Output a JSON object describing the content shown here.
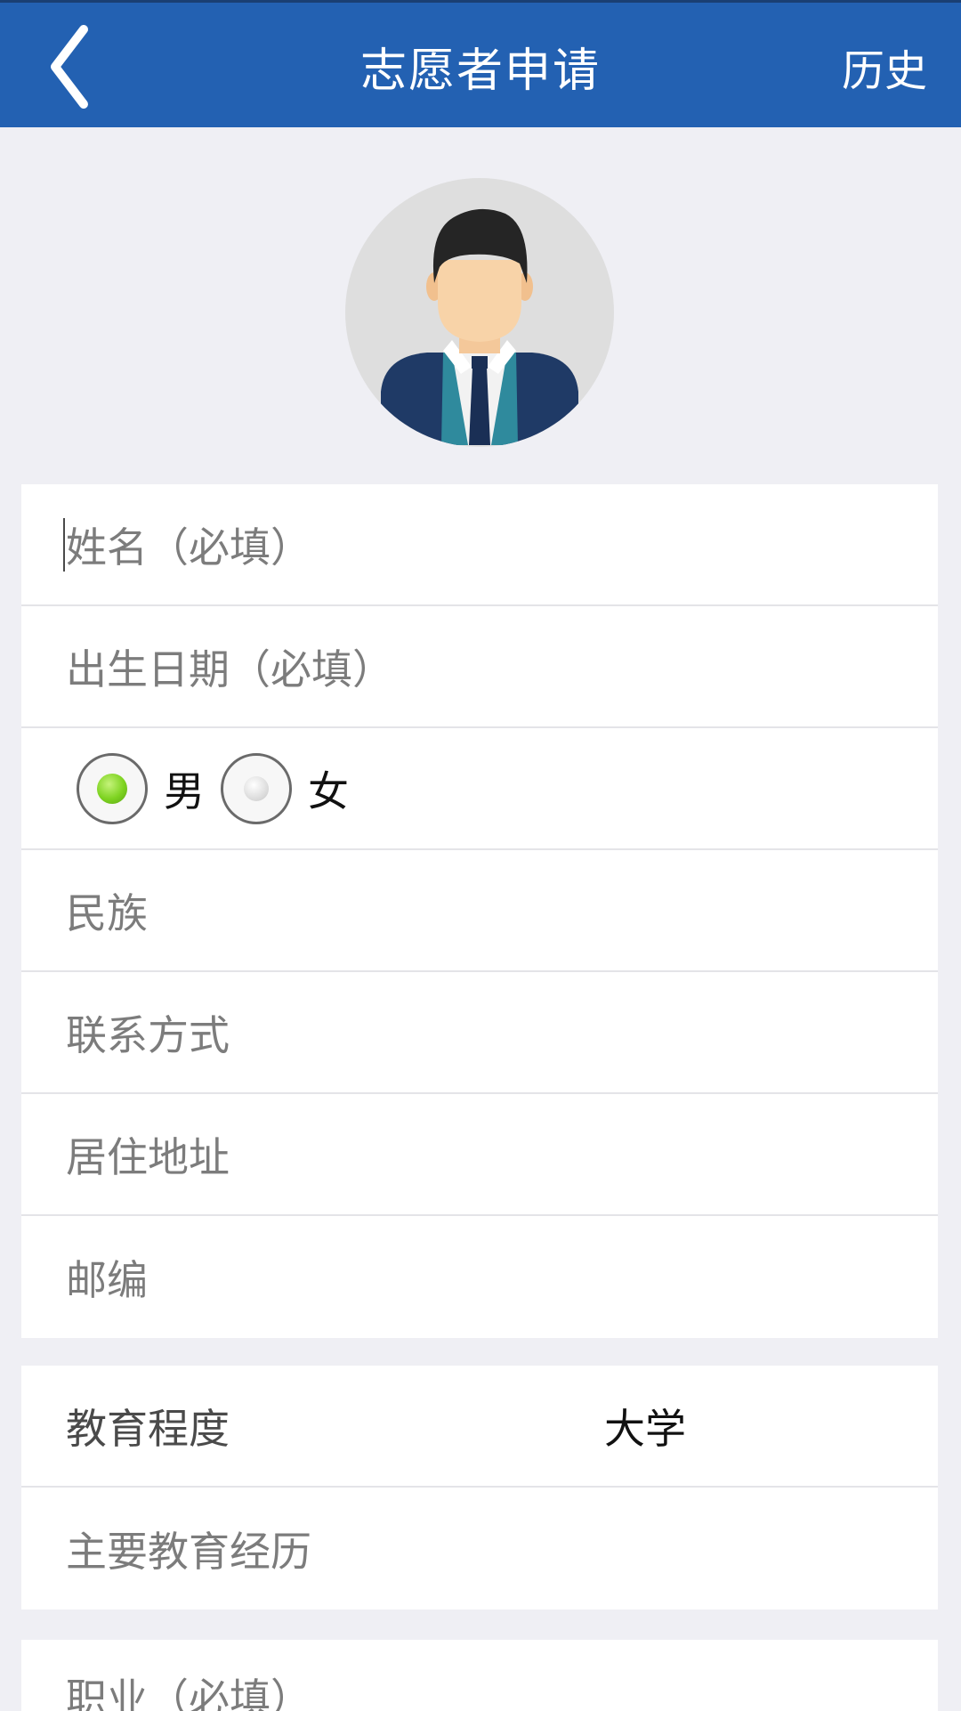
{
  "header": {
    "title": "志愿者申请",
    "history_label": "历史"
  },
  "colors": {
    "header_bg": "#2361b2",
    "page_bg": "#efeff4",
    "radio_selected": "#7ed321"
  },
  "form": {
    "name_placeholder": "姓名（必填）",
    "birthdate_placeholder": "出生日期（必填）",
    "gender": {
      "options": [
        "男",
        "女"
      ],
      "selected": "男"
    },
    "ethnicity_placeholder": "民族",
    "contact_placeholder": "联系方式",
    "address_placeholder": "居住地址",
    "postcode_placeholder": "邮编",
    "education_label": "教育程度",
    "education_value": "大学",
    "education_history_placeholder": "主要教育经历",
    "occupation_placeholder": "职业（必填）"
  },
  "icons": {
    "back": "chevron-left-icon",
    "avatar": "avatar-icon",
    "radio": "radio-icon"
  }
}
